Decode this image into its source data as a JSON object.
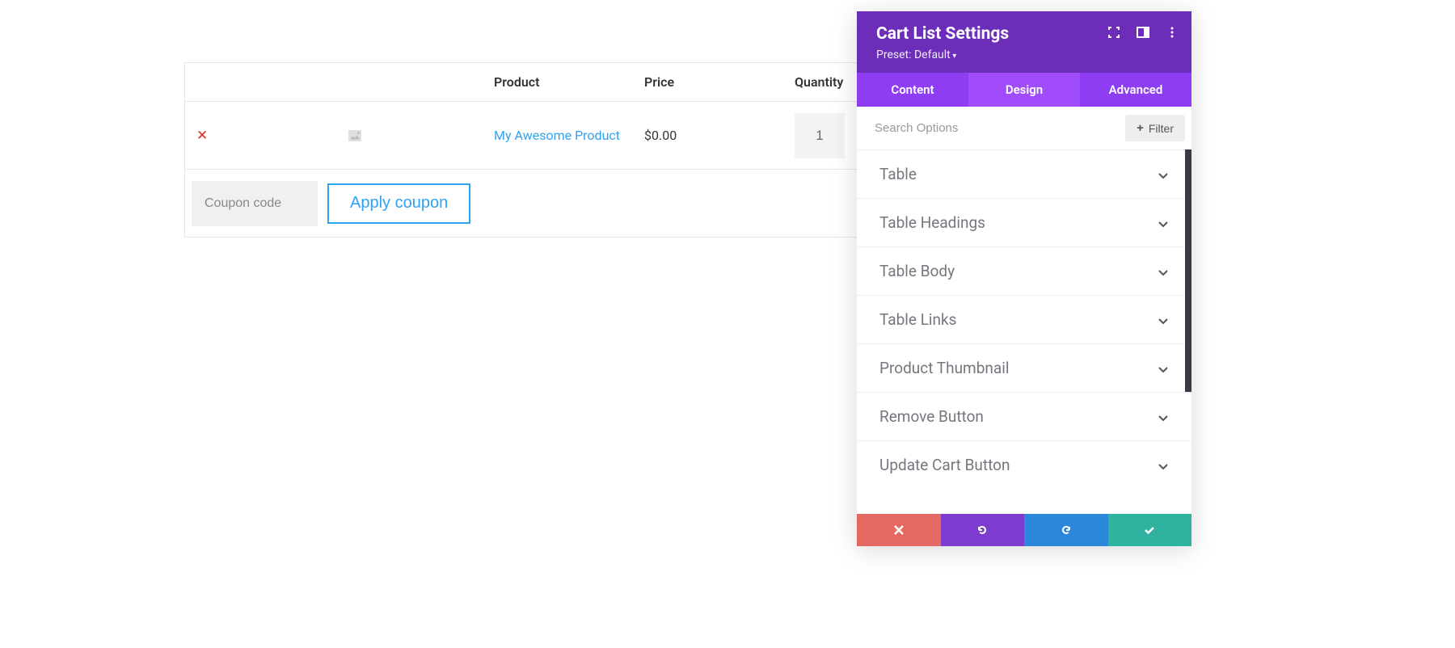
{
  "cart": {
    "headers": {
      "product": "Product",
      "price": "Price",
      "quantity": "Quantity"
    },
    "row": {
      "product_name": "My Awesome Product",
      "price": "$0.00",
      "qty": "1"
    },
    "coupon_placeholder": "Coupon code",
    "apply_label": "Apply coupon"
  },
  "panel": {
    "title": "Cart List Settings",
    "preset": "Preset: Default",
    "tabs": {
      "content": "Content",
      "design": "Design",
      "advanced": "Advanced"
    },
    "search_placeholder": "Search Options",
    "filter_label": "Filter",
    "sections": [
      "Table",
      "Table Headings",
      "Table Body",
      "Table Links",
      "Product Thumbnail",
      "Remove Button",
      "Update Cart Button"
    ]
  }
}
